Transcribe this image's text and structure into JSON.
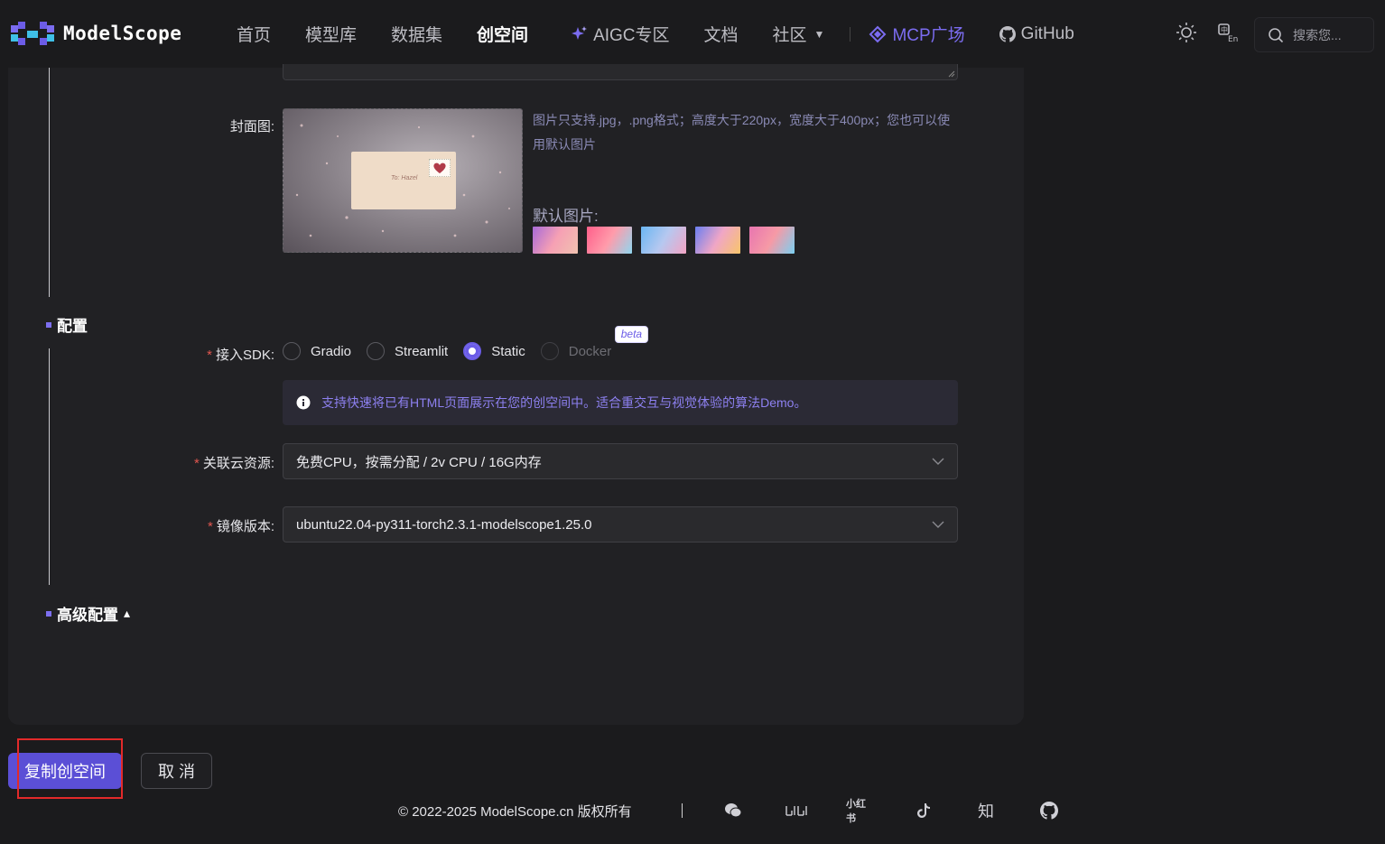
{
  "header": {
    "logo_text": "ModelScope",
    "nav": {
      "home": "首页",
      "models": "模型库",
      "datasets": "数据集",
      "studios": "创空间",
      "aigc": "AIGC专区",
      "docs": "文档",
      "community": "社区",
      "mcp": "MCP广场",
      "github": "GitHub"
    },
    "search_placeholder": "搜索您..."
  },
  "form": {
    "cover_label": "封面图",
    "cover_hint": "图片只支持.jpg，.png格式；高度大于220px，宽度大于400px；您也可以使用默认图片",
    "cover_image_text": "To: Hazel",
    "default_images_label": "默认图片:",
    "default_thumbs": [
      {
        "colors": [
          "#a86ad8",
          "#f6a0b4",
          "#f0c2b0"
        ]
      },
      {
        "colors": [
          "#ff5f8a",
          "#ff9cab",
          "#8fd7f0"
        ]
      },
      {
        "colors": [
          "#6ab6f2",
          "#b6c8f0",
          "#f3a4c4"
        ]
      },
      {
        "colors": [
          "#6a7ef0",
          "#f0a6c6",
          "#f8c56a"
        ]
      },
      {
        "colors": [
          "#e875b0",
          "#f69aa6",
          "#7ad0f2"
        ]
      }
    ],
    "config_section": "配置",
    "sdk_label": "接入SDK",
    "sdk_options": [
      {
        "label": "Gradio",
        "checked": false,
        "disabled": false
      },
      {
        "label": "Streamlit",
        "checked": false,
        "disabled": false
      },
      {
        "label": "Static",
        "checked": true,
        "disabled": false
      },
      {
        "label": "Docker",
        "checked": false,
        "disabled": true
      }
    ],
    "docker_badge": "beta",
    "info_text": "支持快速将已有HTML页面展示在您的创空间中。适合重交互与视觉体验的算法Demo。",
    "resource_label": "关联云资源",
    "resource_value": "免费CPU，按需分配 / 2v CPU / 16G内存",
    "image_version_label": "镜像版本",
    "image_version_value": "ubuntu22.04-py311-torch2.3.1-modelscope1.25.0",
    "advanced_section": "高级配置",
    "advanced_toggle": "▴"
  },
  "actions": {
    "primary": "复制创空间",
    "cancel": "取 消"
  },
  "footer": {
    "copyright": "© 2022-2025 ModelScope.cn 版权所有",
    "xiaohongshu": "小红书",
    "zhihu": "知"
  },
  "colors": {
    "accent": "#5b4fd6",
    "required": "#e0564f",
    "hint": "#8a8ab5"
  }
}
